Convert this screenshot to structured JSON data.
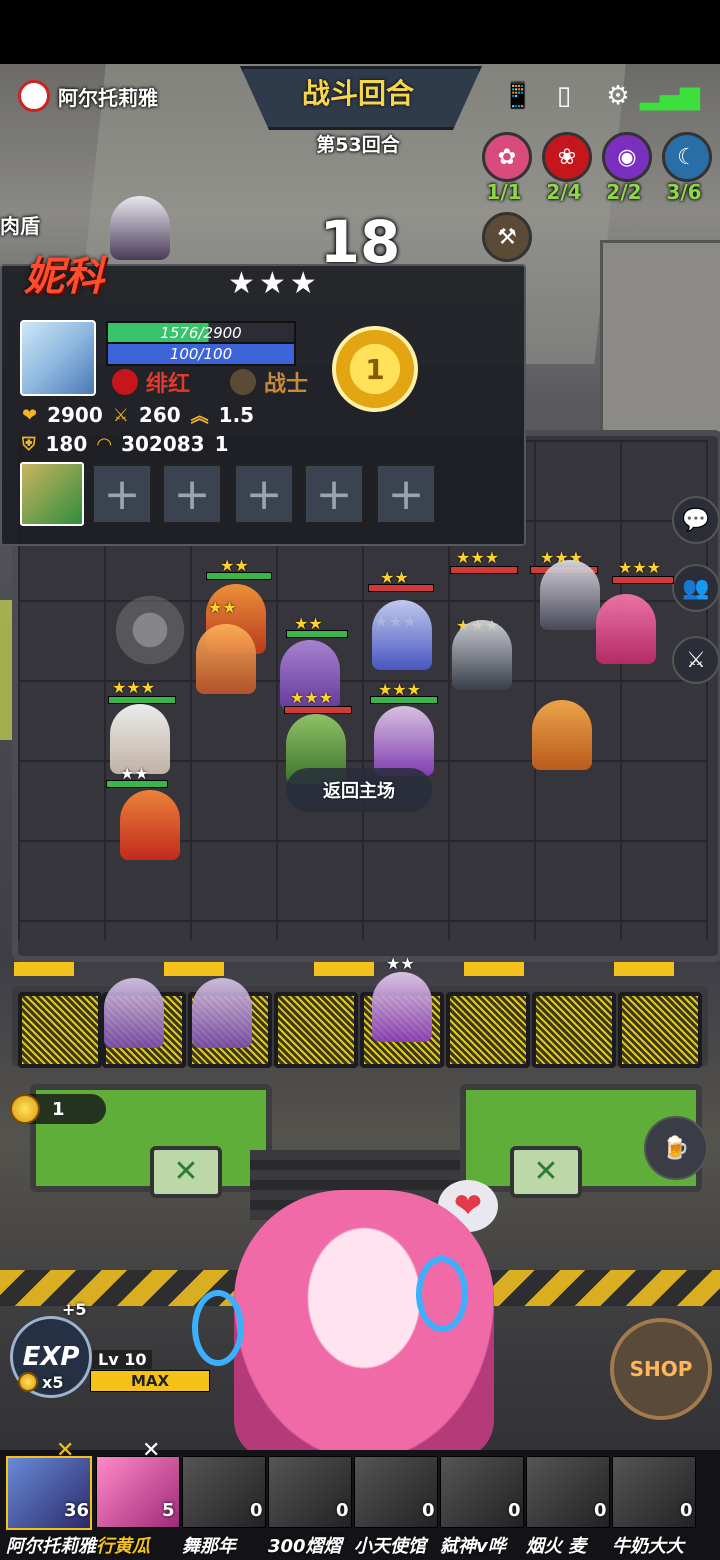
{
  "header": {
    "player_name": "阿尔托莉雅",
    "round_title": "战斗回合",
    "round_number": "第53回合",
    "timer": "18",
    "role_tag": "肉盾"
  },
  "synergies": [
    {
      "icon": "sakura-icon",
      "count": "1/1",
      "color": "#d94b7c"
    },
    {
      "icon": "rose-icon",
      "count": "2/4",
      "color": "#c4161c"
    },
    {
      "icon": "vortex-icon",
      "count": "2/2",
      "color": "#7b2fbf"
    },
    {
      "icon": "moon-icon",
      "count": "3/6",
      "color": "#2a6ea8"
    },
    {
      "icon": "hammer-icon",
      "count": "",
      "color": "#5a4a36"
    }
  ],
  "unit_card": {
    "name": "妮科",
    "stars": "★★★",
    "hp": "1576/2900",
    "hp_fraction": 0.54,
    "mana": "100/100",
    "trait_1": "绯红",
    "trait_2": "战士",
    "medal": "1",
    "stats": {
      "hp": "2900",
      "attack": "260",
      "attack_speed": "1.5",
      "armor": "180",
      "range": "302083",
      "crit": "1"
    },
    "empty_slot": "+"
  },
  "battle": {
    "back_home": "返回主场"
  },
  "gold": "1",
  "exp": {
    "label": "EXP",
    "plus": "+5",
    "cost": "x5",
    "level": "Lv 10",
    "max": "MAX"
  },
  "shop_label": "SHOP",
  "players": [
    {
      "name": "阿尔托莉雅",
      "hp": "36"
    },
    {
      "name": "行黄瓜",
      "hp": "5"
    },
    {
      "name": "舞那年",
      "hp": "0"
    },
    {
      "name": "300熠熠",
      "hp": "0"
    },
    {
      "name": "小天使馆",
      "hp": "0"
    },
    {
      "name": "弑神v哗",
      "hp": "0"
    },
    {
      "name": "烟火 麦",
      "hp": "0"
    },
    {
      "name": "牛奶大大",
      "hp": "0"
    }
  ]
}
